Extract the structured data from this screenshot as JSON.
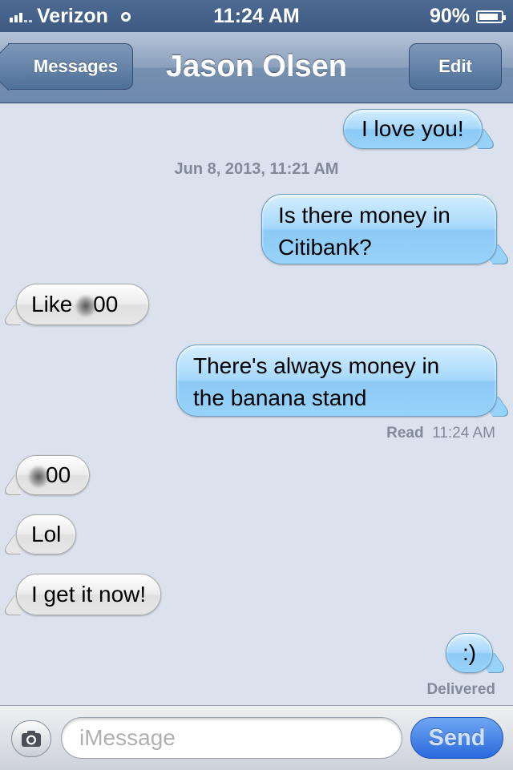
{
  "status_bar": {
    "carrier": "Verizon",
    "time": "11:24 AM",
    "battery": "90%",
    "battery_level": 0.9
  },
  "nav": {
    "back_label": "Messages",
    "title": "Jason Olsen",
    "edit_label": "Edit"
  },
  "thread": {
    "msg1": "I love you!",
    "date_divider": "Jun 8, 2013, 11:21 AM",
    "msg2_line1": "Is there money in",
    "msg2_line2": "Citibank?",
    "msg3_prefix": "Like",
    "msg3_suffix": "00",
    "msg4_line1": "There's always money in",
    "msg4_line2": "the banana stand",
    "read_label": "Read",
    "read_time": "11:24 AM",
    "msg5_suffix": "00",
    "msg6": "Lol",
    "msg7": "I get it now!",
    "msg8": ":)",
    "delivered_label": "Delivered"
  },
  "compose": {
    "placeholder": "iMessage",
    "send_label": "Send"
  }
}
